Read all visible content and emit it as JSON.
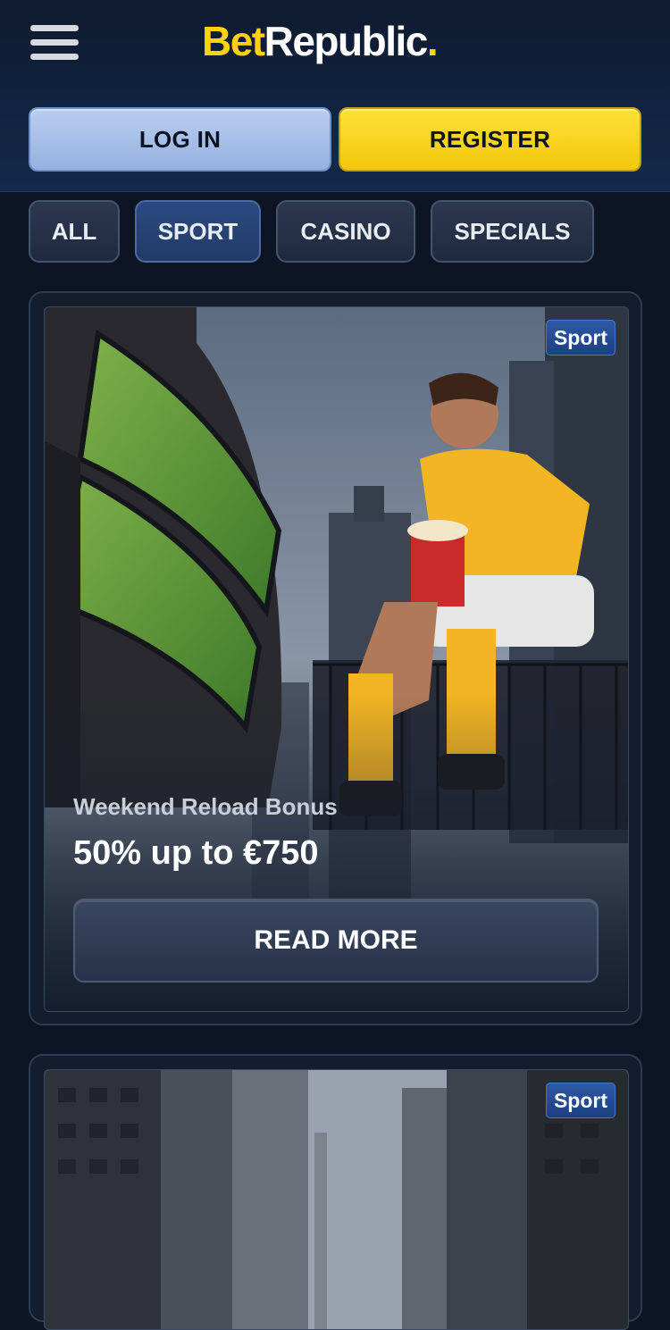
{
  "header": {
    "logo": {
      "part1": "Bet",
      "part2": "Republic",
      "dot": "."
    },
    "login_label": "LOG IN",
    "register_label": "REGISTER"
  },
  "filters": {
    "tabs": [
      {
        "label": "ALL",
        "active": false
      },
      {
        "label": "SPORT",
        "active": true
      },
      {
        "label": "CASINO",
        "active": false
      },
      {
        "label": "SPECIALS",
        "active": false
      }
    ]
  },
  "promos": [
    {
      "category": "Sport",
      "subtitle": "Weekend Reload Bonus",
      "title": "50% up to €750",
      "button_label": "READ MORE"
    },
    {
      "category": "Sport"
    }
  ],
  "colors": {
    "brand_yellow": "#ffd20a",
    "background": "#0d1424",
    "login_blue": "#a6bfea",
    "badge_blue": "#1f4588"
  }
}
